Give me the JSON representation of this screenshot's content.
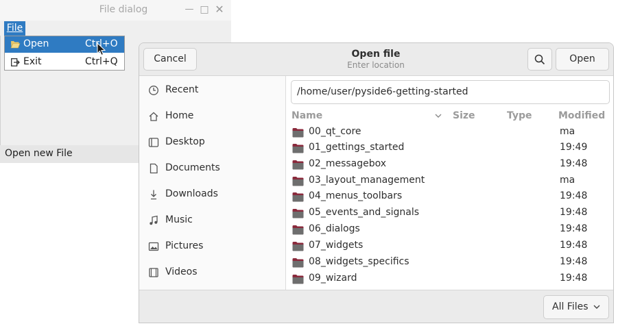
{
  "qt_window": {
    "title": "File dialog",
    "menu": {
      "file_label": "File"
    },
    "dropdown": [
      {
        "label": "Open",
        "shortcut": "Ctrl+O",
        "icon": "folder-open-icon",
        "selected": true
      },
      {
        "label": "Exit",
        "shortcut": "Ctrl+Q",
        "icon": "exit-icon",
        "selected": false
      }
    ],
    "status_text": "Open new File"
  },
  "dialog": {
    "title": "Open file",
    "subtitle": "Enter location",
    "cancel_label": "Cancel",
    "open_label": "Open",
    "location": "/home/user/pyside6-getting-started",
    "sidebar": [
      {
        "label": "Recent",
        "icon": "clock-icon"
      },
      {
        "label": "Home",
        "icon": "home-icon"
      },
      {
        "label": "Desktop",
        "icon": "desktop-icon"
      },
      {
        "label": "Documents",
        "icon": "documents-icon"
      },
      {
        "label": "Downloads",
        "icon": "download-icon"
      },
      {
        "label": "Music",
        "icon": "music-icon"
      },
      {
        "label": "Pictures",
        "icon": "pictures-icon"
      },
      {
        "label": "Videos",
        "icon": "video-icon"
      }
    ],
    "columns": {
      "name": "Name",
      "size": "Size",
      "type": "Type",
      "modified": "Modified"
    },
    "files": [
      {
        "name": "00_qt_core",
        "modified": "ma"
      },
      {
        "name": "01_gettings_started",
        "modified": "19:49"
      },
      {
        "name": "02_messagebox",
        "modified": "19:48"
      },
      {
        "name": "03_layout_management",
        "modified": "ma"
      },
      {
        "name": "04_menus_toolbars",
        "modified": "19:48"
      },
      {
        "name": "05_events_and_signals",
        "modified": "19:48"
      },
      {
        "name": "06_dialogs",
        "modified": "19:48"
      },
      {
        "name": "07_widgets",
        "modified": "19:48"
      },
      {
        "name": "08_widgets_specifics",
        "modified": "19:48"
      },
      {
        "name": "09_wizard",
        "modified": "19:48"
      }
    ],
    "filter_label": "All Files"
  },
  "colors": {
    "selection": "#2f7bc2",
    "folder": "#8a2a3c"
  }
}
